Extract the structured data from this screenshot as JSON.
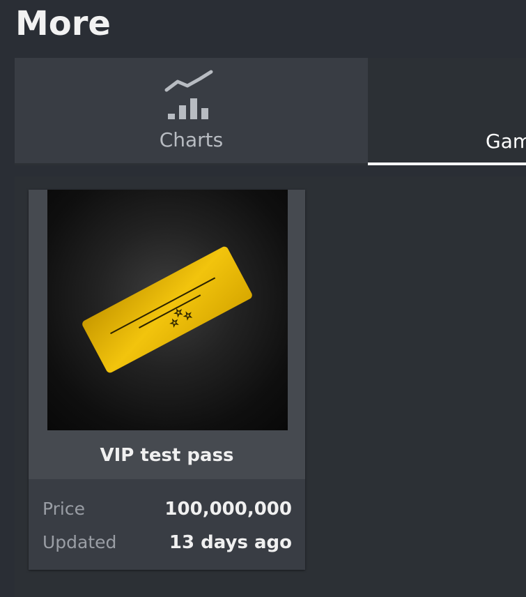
{
  "header": {
    "title": "More"
  },
  "tabs": [
    {
      "label": "Charts",
      "icon": "chart-icon",
      "selected": false
    },
    {
      "label": "Gam",
      "icon": "gamepad-icon",
      "selected": true
    }
  ],
  "item": {
    "name": "VIP test pass",
    "image_icon": "ticket-icon",
    "ticket_color": "#e3b400",
    "stats": {
      "price_label": "Price",
      "price_value": "100,000,000",
      "updated_label": "Updated",
      "updated_value": "13 days ago"
    }
  },
  "colors": {
    "background": "#2a2e35",
    "selected_underline": "#ffffff"
  }
}
